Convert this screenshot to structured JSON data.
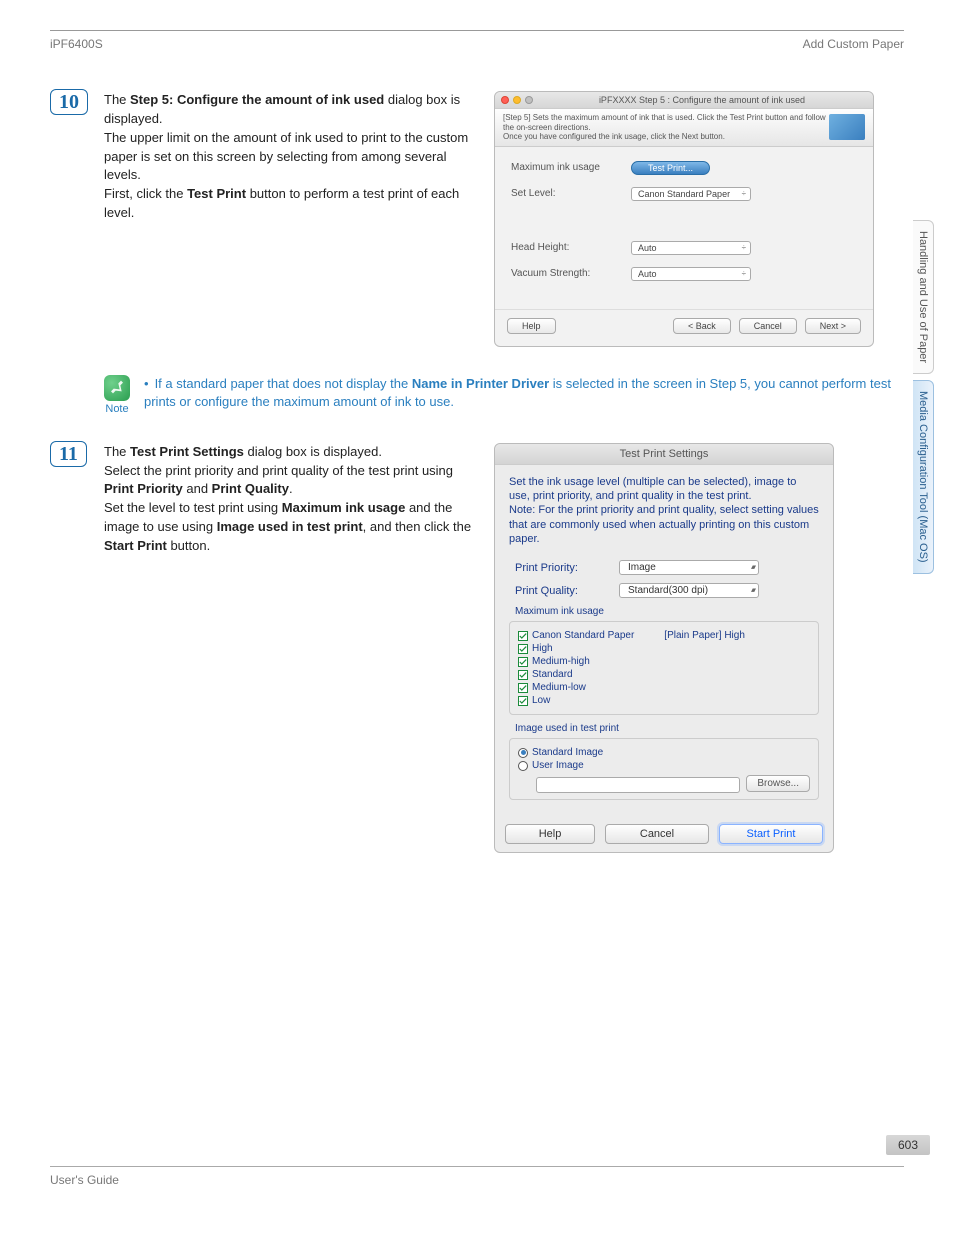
{
  "header": {
    "model": "iPF6400S",
    "section": "Add Custom Paper"
  },
  "steps": {
    "s10": {
      "num": "10",
      "p1a": "The ",
      "p1b": "Step 5: Configure the amount of ink used",
      "p1c": " dialog box is displayed.",
      "p2": "The upper limit on the amount of ink used to print to the custom paper is set on this screen by selecting from among several levels.",
      "p3a": "First, click the ",
      "p3b": "Test Print",
      "p3c": " button to perform a test print of each level."
    },
    "s11": {
      "num": "11",
      "p1a": "The ",
      "p1b": "Test Print Settings",
      "p1c": " dialog box is displayed.",
      "p2a": "Select the print priority and print quality of the test print using ",
      "p2b": "Print Priority",
      "p2c": " and ",
      "p2d": "Print Quality",
      "p2e": ".",
      "p3a": "Set the level to test print using ",
      "p3b": "Maximum ink usage",
      "p3c": " and the image to use using ",
      "p3d": "Image used in test print",
      "p3e": ", and then click the ",
      "p3f": "Start Print",
      "p3g": " button."
    }
  },
  "note": {
    "label": "Note",
    "text_a": "If a standard paper that does not display the ",
    "text_b": "Name in Printer Driver",
    "text_c": " is selected in the screen in Step 5, you cannot perform test prints or configure the maximum amount of ink to use."
  },
  "dlg5": {
    "title": "iPFXXXX Step 5 : Configure the amount of ink used",
    "banner1": "[Step 5] Sets the maximum amount of ink that is used. Click the Test Print button and follow the on-screen directions.",
    "banner2": "Once you have configured the ink usage, click the Next button.",
    "max_label": "Maximum ink usage",
    "test_btn": "Test Print...",
    "set_label": "Set Level:",
    "set_val": "Canon Standard Paper",
    "head_label": "Head Height:",
    "head_val": "Auto",
    "vac_label": "Vacuum Strength:",
    "vac_val": "Auto",
    "help": "Help",
    "back": "< Back",
    "cancel": "Cancel",
    "next": "Next >"
  },
  "tps": {
    "title": "Test Print Settings",
    "intro": "Set the ink usage level (multiple can be selected), image to use, print priority, and print quality in the test print.\nNote: For the print priority and print quality, select setting values that are commonly used when actually printing on this custom paper.",
    "pp_label": "Print Priority:",
    "pp_val": "Image",
    "pq_label": "Print Quality:",
    "pq_val": "Standard(300 dpi)",
    "miu_label": "Maximum ink usage",
    "levels": {
      "csp": "Canon Standard Paper",
      "csp_right": "[Plain Paper] High",
      "high": "High",
      "mh": "Medium-high",
      "std": "Standard",
      "ml": "Medium-low",
      "low": "Low"
    },
    "iutp_label": "Image used in test print",
    "std_img": "Standard Image",
    "usr_img": "User Image",
    "browse": "Browse...",
    "help": "Help",
    "cancel": "Cancel",
    "start": "Start Print"
  },
  "side": {
    "tab1": "Handling and Use of Paper",
    "tab2": "Media Configuration Tool (Mac OS)"
  },
  "footer": {
    "guide": "User's Guide",
    "page": "603"
  }
}
